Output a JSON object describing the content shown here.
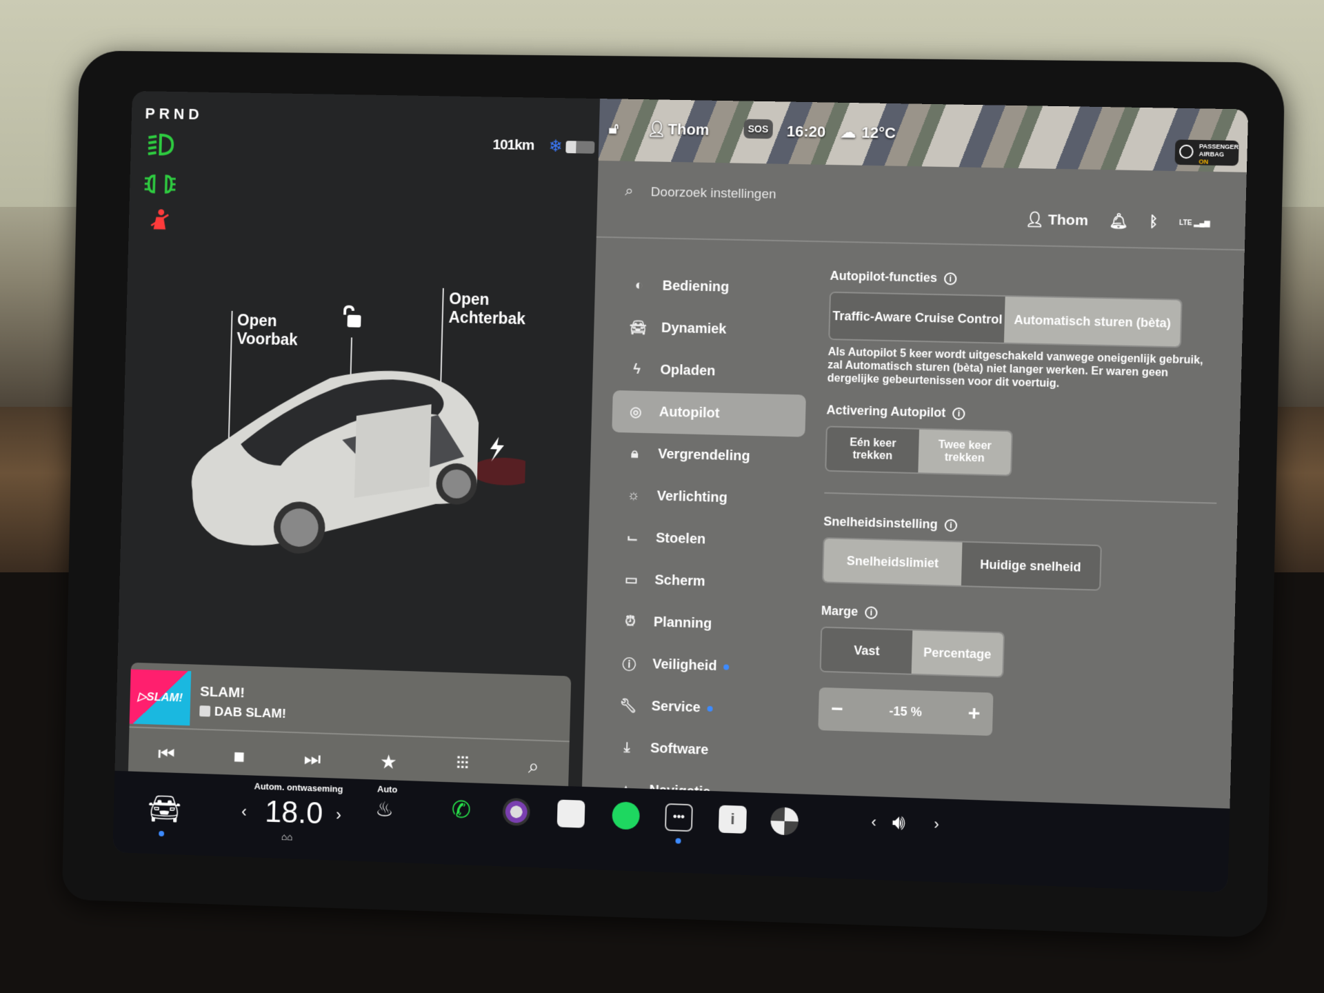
{
  "status": {
    "gear": "PRND",
    "range": "101km",
    "battery_level_percent": 35,
    "tell_tales": [
      {
        "name": "low-beam-icon",
        "color": "#2ecc40"
      },
      {
        "name": "parking-lights-icon",
        "color": "#2ecc40"
      },
      {
        "name": "seatbelt-warning-icon",
        "color": "#ff3b3b"
      }
    ],
    "snow_icon_color": "#3d7bff"
  },
  "car_view": {
    "frunk_label_line1": "Open",
    "frunk_label_line2": "Voorbak",
    "trunk_label_line1": "Open",
    "trunk_label_line2": "Achterbak"
  },
  "media": {
    "station_art": "▷SLAM!",
    "title": "SLAM!",
    "subtitle": "DAB SLAM!",
    "controls": [
      "previous",
      "stop",
      "next",
      "favorite",
      "equalizer",
      "search"
    ]
  },
  "top_strip": {
    "profile": "Thom",
    "sos": "SOS",
    "time": "16:20",
    "temperature": "12°C",
    "airbag_line1": "PASSENGER",
    "airbag_line2": "AIRBAG",
    "airbag_state": "ON"
  },
  "settings": {
    "search_placeholder": "Doorzoek instellingen",
    "user": "Thom",
    "network": "LTE",
    "nav": [
      {
        "label": "Bediening",
        "icon": "toggle-icon",
        "active": false
      },
      {
        "label": "Dynamiek",
        "icon": "car-icon",
        "active": false
      },
      {
        "label": "Opladen",
        "icon": "bolt-icon",
        "active": false
      },
      {
        "label": "Autopilot",
        "icon": "steering-wheel-icon",
        "active": true
      },
      {
        "label": "Vergrendeling",
        "icon": "lock-icon",
        "active": false
      },
      {
        "label": "Verlichting",
        "icon": "sun-icon",
        "active": false
      },
      {
        "label": "Stoelen",
        "icon": "seat-icon",
        "active": false
      },
      {
        "label": "Scherm",
        "icon": "display-icon",
        "active": false
      },
      {
        "label": "Planning",
        "icon": "alarm-icon",
        "active": false
      },
      {
        "label": "Veiligheid",
        "icon": "alert-icon",
        "active": false,
        "badge": true
      },
      {
        "label": "Service",
        "icon": "wrench-icon",
        "active": false,
        "badge": true
      },
      {
        "label": "Software",
        "icon": "download-icon",
        "active": false
      },
      {
        "label": "Navigatie",
        "icon": "navigation-icon",
        "active": false
      }
    ],
    "autopilot": {
      "features_label": "Autopilot-functies",
      "features_options": [
        "Traffic-Aware Cruise Control",
        "Automatisch sturen (bèta)"
      ],
      "features_selected": 1,
      "features_description": "Als Autopilot 5 keer wordt uitgeschakeld vanwege oneigenlijk gebruik, zal Automatisch sturen (bèta) niet langer werken. Er waren geen dergelijke gebeurtenissen voor dit voertuig.",
      "activation_label": "Activering Autopilot",
      "activation_options": [
        "Eén keer trekken",
        "Twee keer trekken"
      ],
      "activation_selected": 1,
      "speed_label": "Snelheidsinstelling",
      "speed_options": [
        "Snelheidslimiet",
        "Huidige snelheid"
      ],
      "speed_selected": 0,
      "margin_label": "Marge",
      "margin_options": [
        "Vast",
        "Percentage"
      ],
      "margin_selected": 1,
      "margin_value": "-15 %",
      "minus": "−",
      "plus": "+"
    }
  },
  "dock": {
    "defrost_label": "Autom. ontwaseming",
    "temperature": "18.0",
    "seat_heat_label": "Auto",
    "apps": [
      "phone",
      "camera",
      "calendar",
      "spotify",
      "messages",
      "manual",
      "fan"
    ],
    "volume_icon": "speaker"
  }
}
